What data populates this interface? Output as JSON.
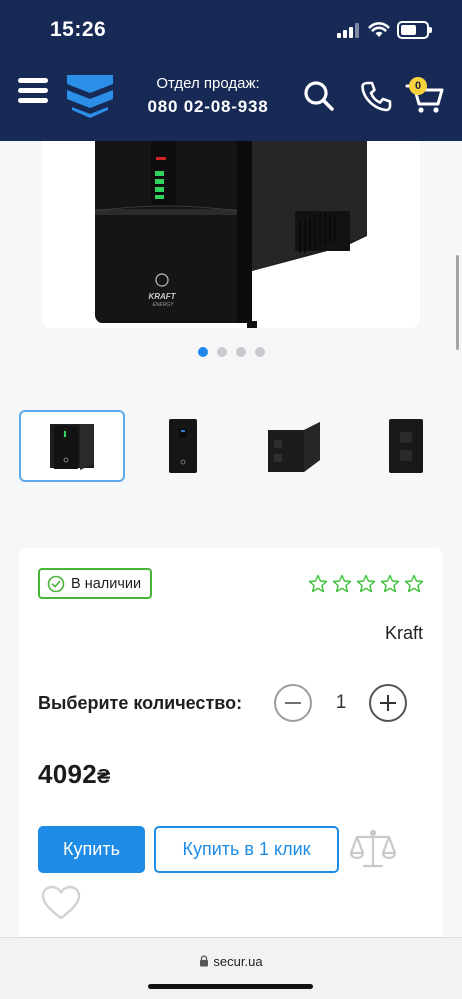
{
  "status_bar": {
    "time": "15:26",
    "icons": [
      "cellular-signal-icon",
      "wifi-icon",
      "battery-icon"
    ]
  },
  "header": {
    "menu_icon": "hamburger-menu-icon",
    "logo_icon": "secur-chevron-logo",
    "sales_label": "Отдел продаж:",
    "sales_phone": "080 02-08-938",
    "search_icon": "search-icon",
    "phone_icon": "phone-icon",
    "cart_icon": "cart-icon",
    "cart_count": "0",
    "colors": {
      "background": "#172a55",
      "logo": "#2b8fe8",
      "badge": "#f7d23e"
    }
  },
  "gallery": {
    "main_image": "ups-device-image",
    "logo_text": "KRAFT",
    "logo_subtext": "ENERGY",
    "dots": {
      "count": 4,
      "active_index": 0
    },
    "thumbnails": [
      {
        "name": "ups-front-angle-thumbnail"
      },
      {
        "name": "ups-front-thumbnail"
      },
      {
        "name": "ups-side-thumbnail"
      },
      {
        "name": "ups-back-thumbnail"
      }
    ],
    "active_thumbnail": 0
  },
  "product": {
    "availability": "В наличии",
    "rating": {
      "value": 0,
      "max": 5
    },
    "brand": "Kraft",
    "quantity_label": "Выберите количество:",
    "quantity": "1",
    "price": "4092",
    "currency": "₴",
    "buy_label": "Купить",
    "one_click_label": "Купить в 1 клик",
    "compare_icon": "scales-compare-icon",
    "wishlist_icon": "heart-icon",
    "colors": {
      "accent": "#1e8ce6",
      "in_stock": "#49b33a"
    }
  },
  "browser": {
    "url": "secur.ua",
    "lock_icon": "lock-icon"
  }
}
